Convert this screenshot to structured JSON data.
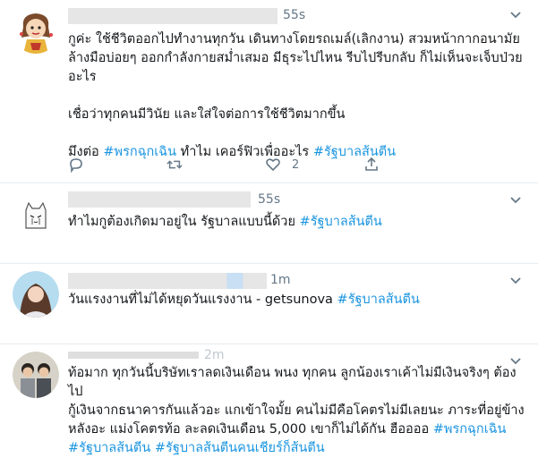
{
  "tweets": [
    {
      "time": "55s",
      "lines": [
        "กูค่ะ ใช้ชีวิตออกไปทำงานทุกวัน เดินทางโดยรถเมล์(เลิกงาน) สวมหน้ากากอนามัย",
        "ล้างมือบ่อยๆ ออกกำลังกายสม่ำเสมอ มีธุระไปไหน รีบไปรีบกลับ ก็ไม่เห็นจะเจ็บป่วย",
        "อะไร",
        "",
        "เชื่อว่าทุกคนมีวินัย และใส่ใจต่อการใช้ชีวิตมากขึ้น",
        ""
      ],
      "last_line_prefix": "มึงต่อ ",
      "tag1": "#พรกฉุกเฉิน",
      "last_line_mid": " ทำไม เคอร์ฟิวเพื่ออะไร ",
      "tag2": "#รัฐบาลส้นตีน",
      "like_count": "2"
    },
    {
      "time": "55s",
      "text": "ทำไมกูต้องเกิดมาอยู่ใน รัฐบาลแบบนี้ด้วย ",
      "tag": "#รัฐบาลส้นตีน"
    },
    {
      "time": "1m",
      "text": "วันแรงงานที่ไม่ได้หยุดวันแรงงาน - getsunova ",
      "tag": "#รัฐบาลส้นตีน"
    },
    {
      "time": "2m",
      "line1": "ท้อมาก ทุกวันนี้บริษัทเราลดเงินเดือน พนง ทุกคน ลูกน้องเราเค้าไม่มีเงินจริงๆ ต้องไป",
      "line2": "กู้เงินจากธนาคารกันแล้วอะ แกเข้าใจมั้ย คนไม่มีคือโคตรไม่มีเลยนะ ภาระที่อยู่ข้าง",
      "line3_text": "หลังอะ แม่งโคตรท้อ ละลดเงินเดือน 5,000 เขาก็ไม่ได้กัน ฮืออออ ",
      "line3_tag": "#พรกฉุกเฉิน",
      "line4_tag1": "#รัฐบาลส้นตีน",
      "line4_tag2": "#รัฐบาลส้นตีนคนเชียร์ก็ส้นตีน"
    }
  ],
  "colors": {
    "hashtag": "#1b95e0",
    "icon": "#657786",
    "border": "#e6ecf0",
    "blurred_name": "#e6e6e6"
  },
  "icons": [
    "reply-icon",
    "retweet-icon",
    "like-icon",
    "share-icon",
    "chevron-down-icon"
  ]
}
